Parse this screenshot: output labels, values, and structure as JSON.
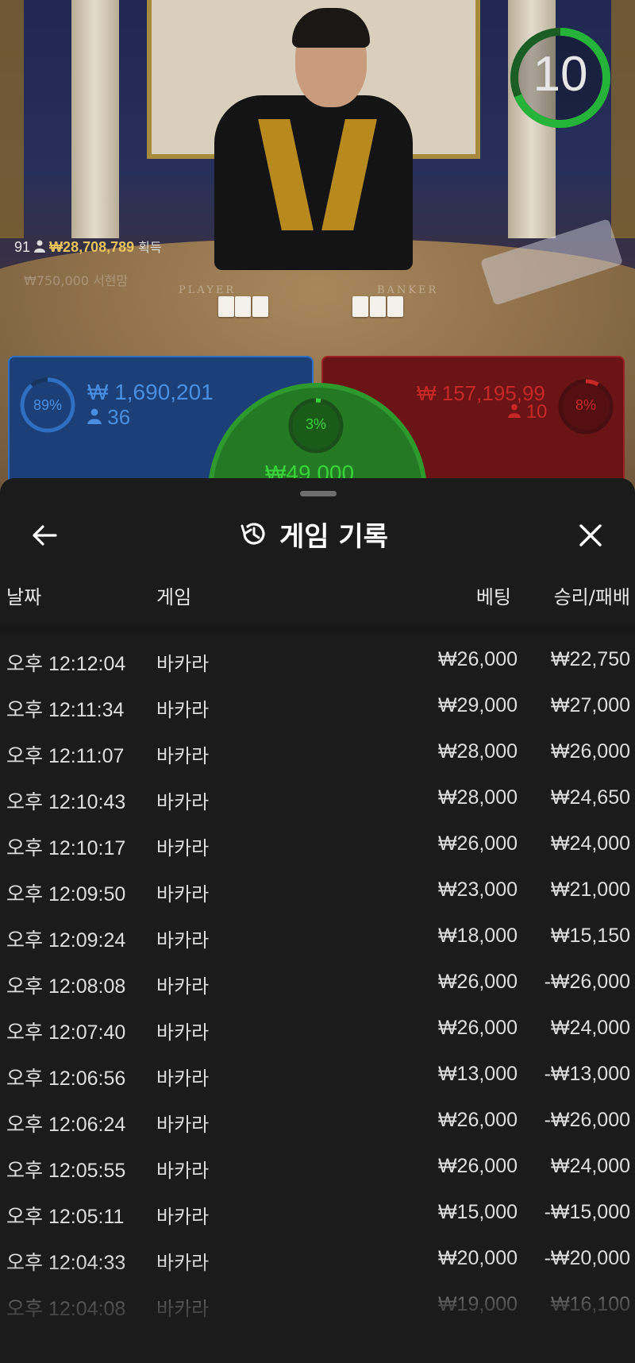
{
  "stream": {
    "timer": "10",
    "timer_color": "#26b33a",
    "player_count": "91",
    "win_amount": "₩28,708,789",
    "win_label": "획득",
    "ghost_text": "₩750,000 서현맘",
    "table_player_text": "PLAYER",
    "table_banker_text": "BANKER"
  },
  "bets": {
    "player": {
      "percent": "89%",
      "amount": "₩ 1,690,201",
      "count": "36",
      "color": "#2f6fc2"
    },
    "banker": {
      "percent": "8%",
      "amount": "₩ 157,195,99",
      "count": "10",
      "color": "#c62828"
    },
    "tie": {
      "percent": "3%",
      "amount": "₩49,000",
      "color": "#2e9a2e"
    }
  },
  "sheet": {
    "title": "게임 기록",
    "back_icon": "arrow-left-icon",
    "history_icon": "history-icon",
    "close_icon": "close-icon",
    "columns": {
      "date": "날짜",
      "game": "게임",
      "bet": "베팅",
      "winloss": "승리/패배"
    },
    "rows": [
      {
        "date": "오후 12:12:04",
        "game": "바카라",
        "bet": "₩26,000",
        "winloss": "₩22,750"
      },
      {
        "date": "오후 12:11:34",
        "game": "바카라",
        "bet": "₩29,000",
        "winloss": "₩27,000"
      },
      {
        "date": "오후 12:11:07",
        "game": "바카라",
        "bet": "₩28,000",
        "winloss": "₩26,000"
      },
      {
        "date": "오후 12:10:43",
        "game": "바카라",
        "bet": "₩28,000",
        "winloss": "₩24,650"
      },
      {
        "date": "오후 12:10:17",
        "game": "바카라",
        "bet": "₩26,000",
        "winloss": "₩24,000"
      },
      {
        "date": "오후 12:09:50",
        "game": "바카라",
        "bet": "₩23,000",
        "winloss": "₩21,000"
      },
      {
        "date": "오후 12:09:24",
        "game": "바카라",
        "bet": "₩18,000",
        "winloss": "₩15,150"
      },
      {
        "date": "오후 12:08:08",
        "game": "바카라",
        "bet": "₩26,000",
        "winloss": "-₩26,000"
      },
      {
        "date": "오후 12:07:40",
        "game": "바카라",
        "bet": "₩26,000",
        "winloss": "₩24,000"
      },
      {
        "date": "오후 12:06:56",
        "game": "바카라",
        "bet": "₩13,000",
        "winloss": "-₩13,000"
      },
      {
        "date": "오후 12:06:24",
        "game": "바카라",
        "bet": "₩26,000",
        "winloss": "-₩26,000"
      },
      {
        "date": "오후 12:05:55",
        "game": "바카라",
        "bet": "₩26,000",
        "winloss": "₩24,000"
      },
      {
        "date": "오후 12:05:11",
        "game": "바카라",
        "bet": "₩15,000",
        "winloss": "-₩15,000"
      },
      {
        "date": "오후 12:04:33",
        "game": "바카라",
        "bet": "₩20,000",
        "winloss": "-₩20,000"
      },
      {
        "date": "오후 12:04:08",
        "game": "바카라",
        "bet": "₩19,000",
        "winloss": "₩16,100"
      }
    ]
  }
}
